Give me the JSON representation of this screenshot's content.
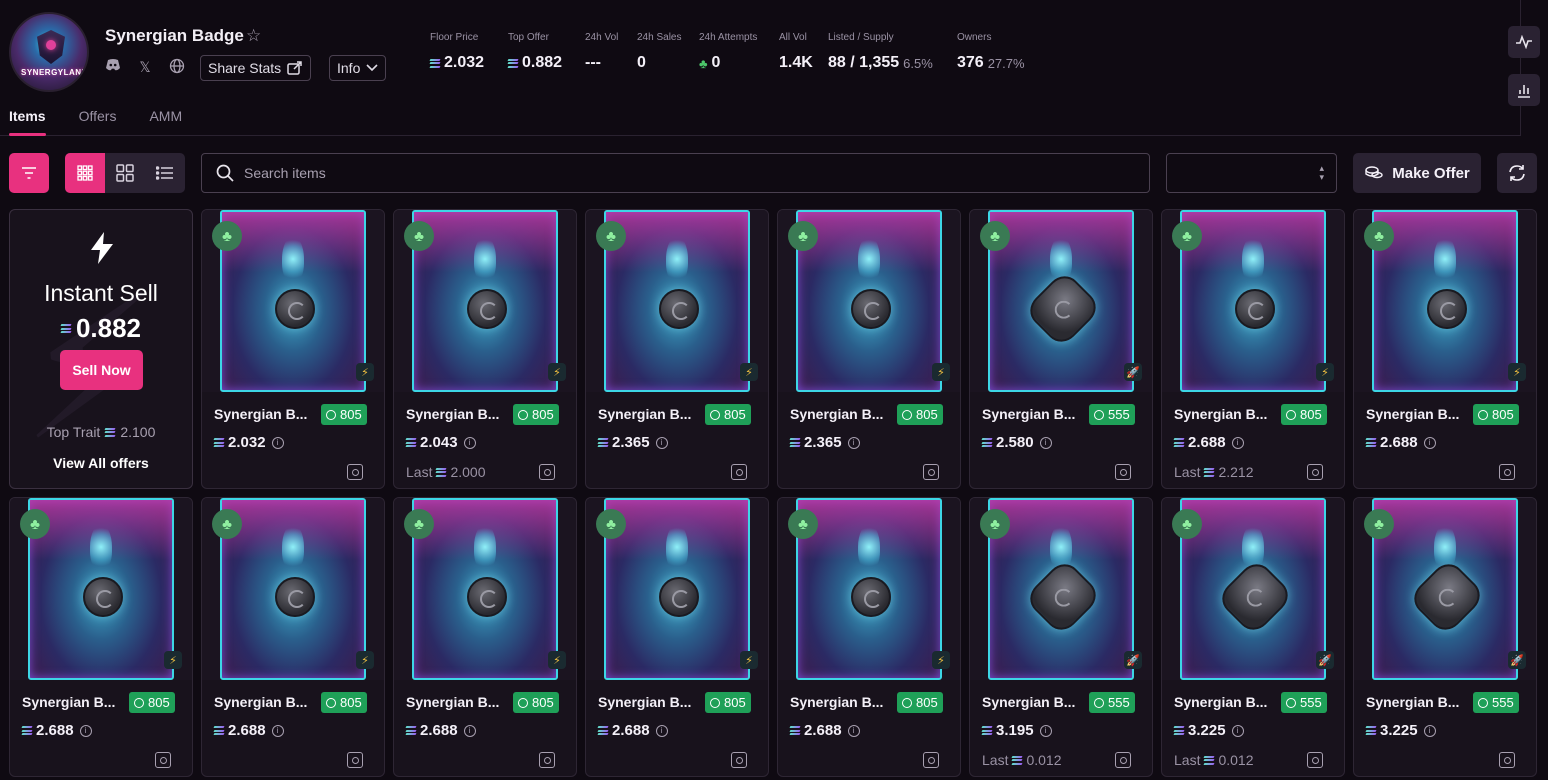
{
  "collection": {
    "title": "Synergian Badge",
    "avatar_text": "SYNERGYLAND",
    "share_label": "Share Stats",
    "info_label": "Info"
  },
  "stats": [
    {
      "label": "Floor Price",
      "value": "2.032",
      "sol": true
    },
    {
      "label": "Top Offer",
      "value": "0.882",
      "sol": true
    },
    {
      "label": "24h Vol",
      "value": "---"
    },
    {
      "label": "24h Sales",
      "value": "0"
    },
    {
      "label": "24h Attempts",
      "value": "0",
      "clover": true
    },
    {
      "label": "All Vol",
      "value": "1.4K"
    },
    {
      "label": "Listed / Supply",
      "value": "88 / 1,355",
      "pct": "6.5%"
    },
    {
      "label": "Owners",
      "value": "376",
      "pct": "27.7%"
    }
  ],
  "tabs": [
    "Items",
    "Offers",
    "AMM"
  ],
  "search": {
    "placeholder": "Search items"
  },
  "toolbar": {
    "make_offer": "Make Offer"
  },
  "instant_sell": {
    "title": "Instant Sell",
    "price": "0.882",
    "button": "Sell Now",
    "top_trait_label": "Top Trait",
    "top_trait_value": "2.100",
    "view_all": "View All offers"
  },
  "items": [
    {
      "name": "Synergian B...",
      "rank": "805",
      "price": "2.032",
      "last": "",
      "variant": "coin"
    },
    {
      "name": "Synergian B...",
      "rank": "805",
      "price": "2.043",
      "last": "2.000",
      "variant": "coin"
    },
    {
      "name": "Synergian B...",
      "rank": "805",
      "price": "2.365",
      "last": "",
      "variant": "coin"
    },
    {
      "name": "Synergian B...",
      "rank": "805",
      "price": "2.365",
      "last": "",
      "variant": "coin"
    },
    {
      "name": "Synergian B...",
      "rank": "555",
      "price": "2.580",
      "last": "",
      "variant": "big"
    },
    {
      "name": "Synergian B...",
      "rank": "805",
      "price": "2.688",
      "last": "2.212",
      "variant": "coin"
    },
    {
      "name": "Synergian B...",
      "rank": "805",
      "price": "2.688",
      "last": "",
      "variant": "coin"
    },
    {
      "name": "Synergian B...",
      "rank": "805",
      "price": "2.688",
      "last": "",
      "variant": "coin"
    },
    {
      "name": "Synergian B...",
      "rank": "805",
      "price": "2.688",
      "last": "",
      "variant": "coin"
    },
    {
      "name": "Synergian B...",
      "rank": "805",
      "price": "2.688",
      "last": "",
      "variant": "coin"
    },
    {
      "name": "Synergian B...",
      "rank": "805",
      "price": "2.688",
      "last": "",
      "variant": "coin"
    },
    {
      "name": "Synergian B...",
      "rank": "805",
      "price": "2.688",
      "last": "",
      "variant": "coin"
    },
    {
      "name": "Synergian B...",
      "rank": "555",
      "price": "3.195",
      "last": "0.012",
      "variant": "big"
    },
    {
      "name": "Synergian B...",
      "rank": "555",
      "price": "3.225",
      "last": "0.012",
      "variant": "big"
    },
    {
      "name": "Synergian B...",
      "rank": "555",
      "price": "3.225",
      "last": "",
      "variant": "big"
    }
  ],
  "last_label": "Last"
}
